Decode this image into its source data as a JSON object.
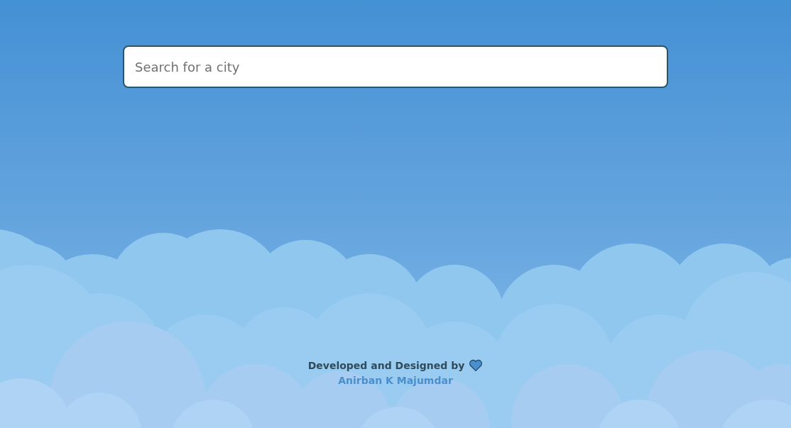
{
  "search": {
    "placeholder": "Search for a city"
  },
  "footer": {
    "credit": "Developed and Designed by",
    "author": "Anirban K Majumdar"
  }
}
